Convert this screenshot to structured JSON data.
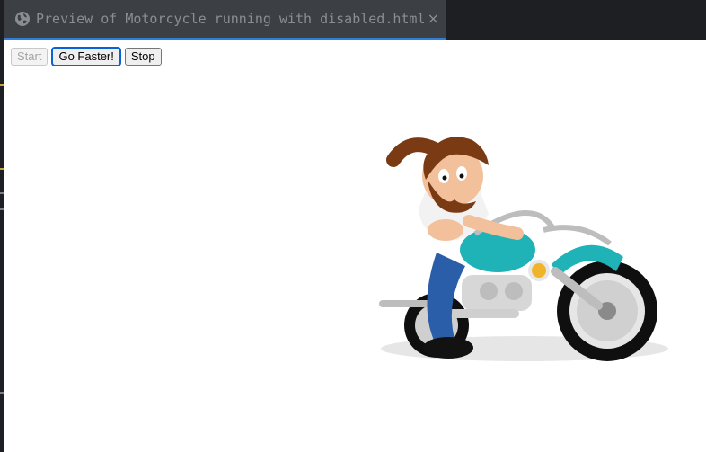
{
  "tab": {
    "icon": "globe-icon",
    "title": "Preview of Motorcycle running with disabled.html",
    "close": "×"
  },
  "controls": {
    "start_label": "Start",
    "faster_label": "Go Faster!",
    "stop_label": "Stop"
  },
  "image": {
    "subject": "biker-on-motorcycle-animation"
  },
  "colors": {
    "editor_bg": "#1e1f22",
    "tab_bg": "#3c3f44",
    "tab_accent": "#2f7fd6",
    "tab_text": "#8a8d93",
    "bike_body": "#1fb3b8"
  }
}
